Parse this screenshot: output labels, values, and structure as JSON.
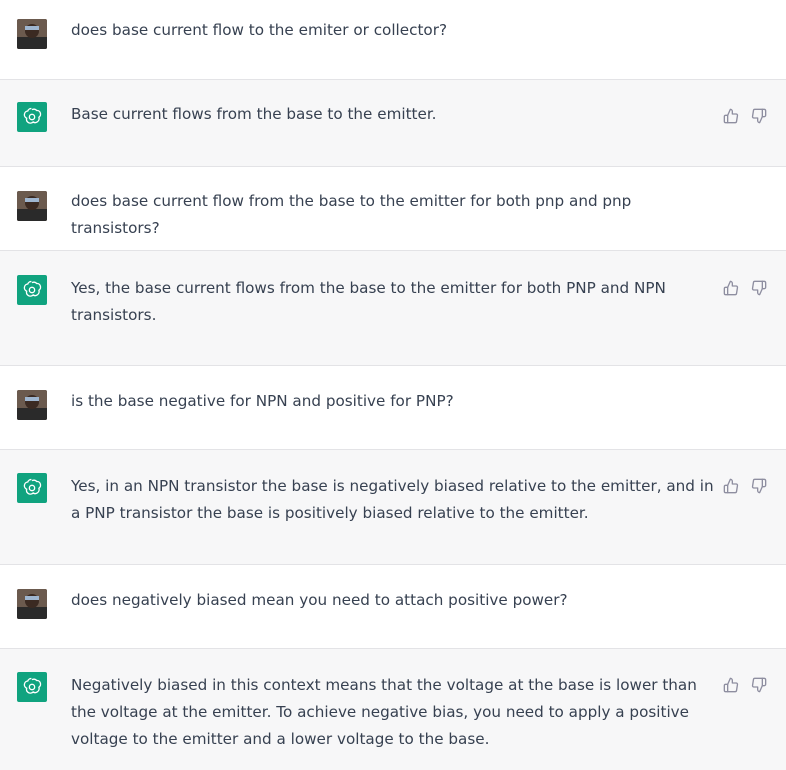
{
  "conversation": {
    "messages": [
      {
        "role": "user",
        "text": "does base current flow to the emiter or collector?"
      },
      {
        "role": "assistant",
        "text": "Base current flows from the base to the emitter."
      },
      {
        "role": "user",
        "text": "does base current flow from the base to the emitter for both pnp and pnp transistors?"
      },
      {
        "role": "assistant",
        "text": "Yes, the base current flows from the base to the emitter for both PNP and NPN transistors."
      },
      {
        "role": "user",
        "text": "is the base negative for NPN and positive for PNP?"
      },
      {
        "role": "assistant",
        "text": "Yes, in an NPN transistor the base is negatively biased relative to the emitter, and in a PNP transistor the base is positively biased relative to the emitter."
      },
      {
        "role": "user",
        "text": "does negatively biased mean you need to attach positive power?"
      },
      {
        "role": "assistant",
        "text": "Negatively biased in this context means that the voltage at the base is lower than the voltage at the emitter. To achieve negative bias, you need to apply a positive voltage to the emitter and a lower voltage to the base."
      }
    ]
  },
  "icons": {
    "user_avatar": "user-avatar",
    "assistant_avatar": "openai-logo-icon",
    "like": "thumbs-up-icon",
    "dislike": "thumbs-down-icon"
  },
  "colors": {
    "assistant_bg": "#f7f7f8",
    "brand_green": "#10a37f",
    "text": "#374151",
    "icon": "#8e8ea0"
  }
}
